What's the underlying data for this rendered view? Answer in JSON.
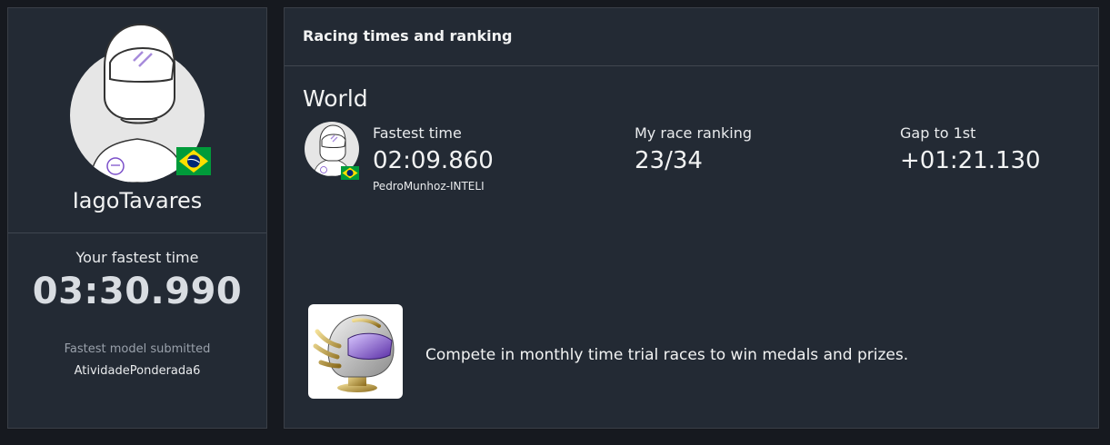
{
  "profile": {
    "username": "IagoTavares",
    "country_flag": "brazil-flag",
    "fastest_label": "Your fastest time",
    "fastest_value": "03:30.990",
    "model_label": "Fastest model submitted",
    "model_value": "AtividadePonderada6"
  },
  "racing": {
    "header": "Racing times and ranking",
    "region": "World",
    "fastest_time": {
      "label": "Fastest time",
      "value": "02:09.860",
      "holder": "PedroMunhoz-INTELI"
    },
    "ranking": {
      "label": "My race ranking",
      "value": "23/34"
    },
    "gap": {
      "label": "Gap to 1st",
      "value": "+01:21.130"
    },
    "promo_text": "Compete in monthly time trial races to win medals and prizes."
  },
  "colors": {
    "background": "#16191f",
    "card": "#232a34",
    "helmet_visor": "#a78bdb",
    "flag_green": "#009b3a",
    "flag_yellow": "#fedf00",
    "flag_blue": "#002776"
  }
}
